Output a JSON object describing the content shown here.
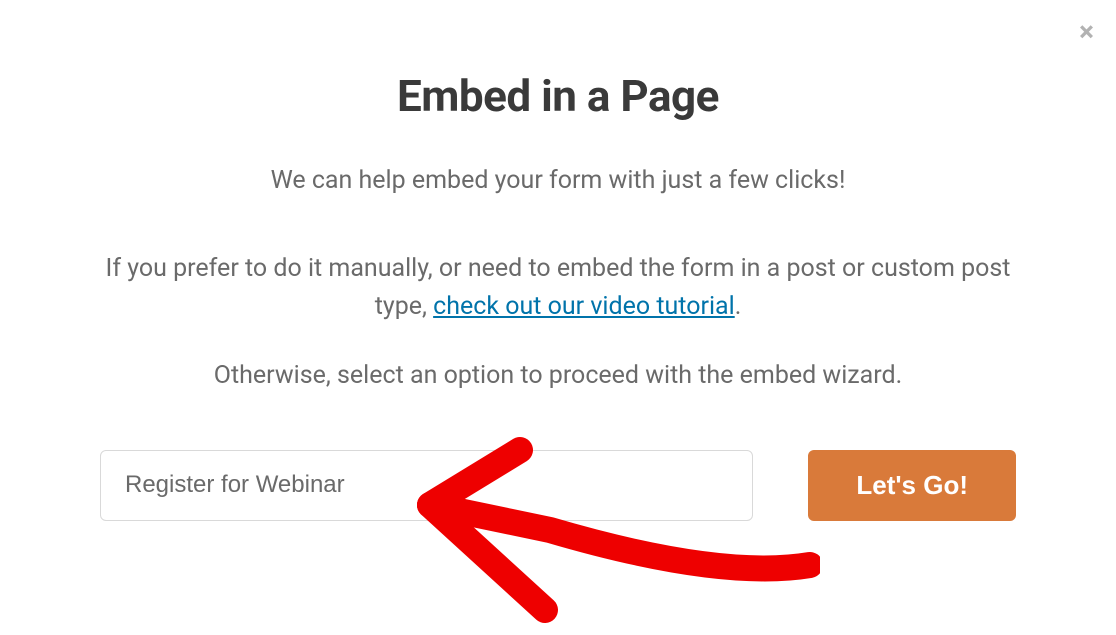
{
  "modal": {
    "close_label": "×",
    "title": "Embed in a Page",
    "subtitle": "We can help embed your form with just a few clicks!",
    "description_prefix": "If you prefer to do it manually, or need to embed the form in a post or custom post type, ",
    "description_link": "check out our video tutorial",
    "description_suffix": ".",
    "instruction": "Otherwise, select an option to proceed with the embed wizard.",
    "input_value": "Register for Webinar",
    "go_button_label": "Let's Go!"
  }
}
